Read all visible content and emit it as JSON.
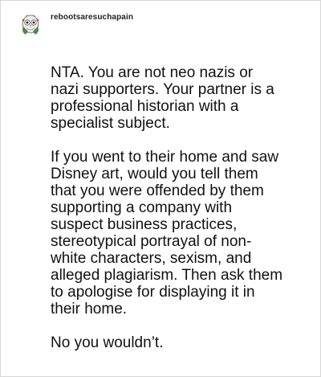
{
  "post": {
    "username": "rebootsaresuchapain",
    "avatar_icon": "snowy-owl-avatar-icon",
    "paragraphs": [
      "NTA. You are not neo nazis or nazi supporters. Your partner is a professional historian with a specialist subject.",
      "If you went to their home and saw Disney art, would you tell them that you were offended by them supporting a company with suspect business practices, stereotypical portrayal of non-white characters, sexism, and alleged plagiarism. Then ask them to apologise for displaying it in their home.",
      "No you wouldn’t."
    ]
  }
}
